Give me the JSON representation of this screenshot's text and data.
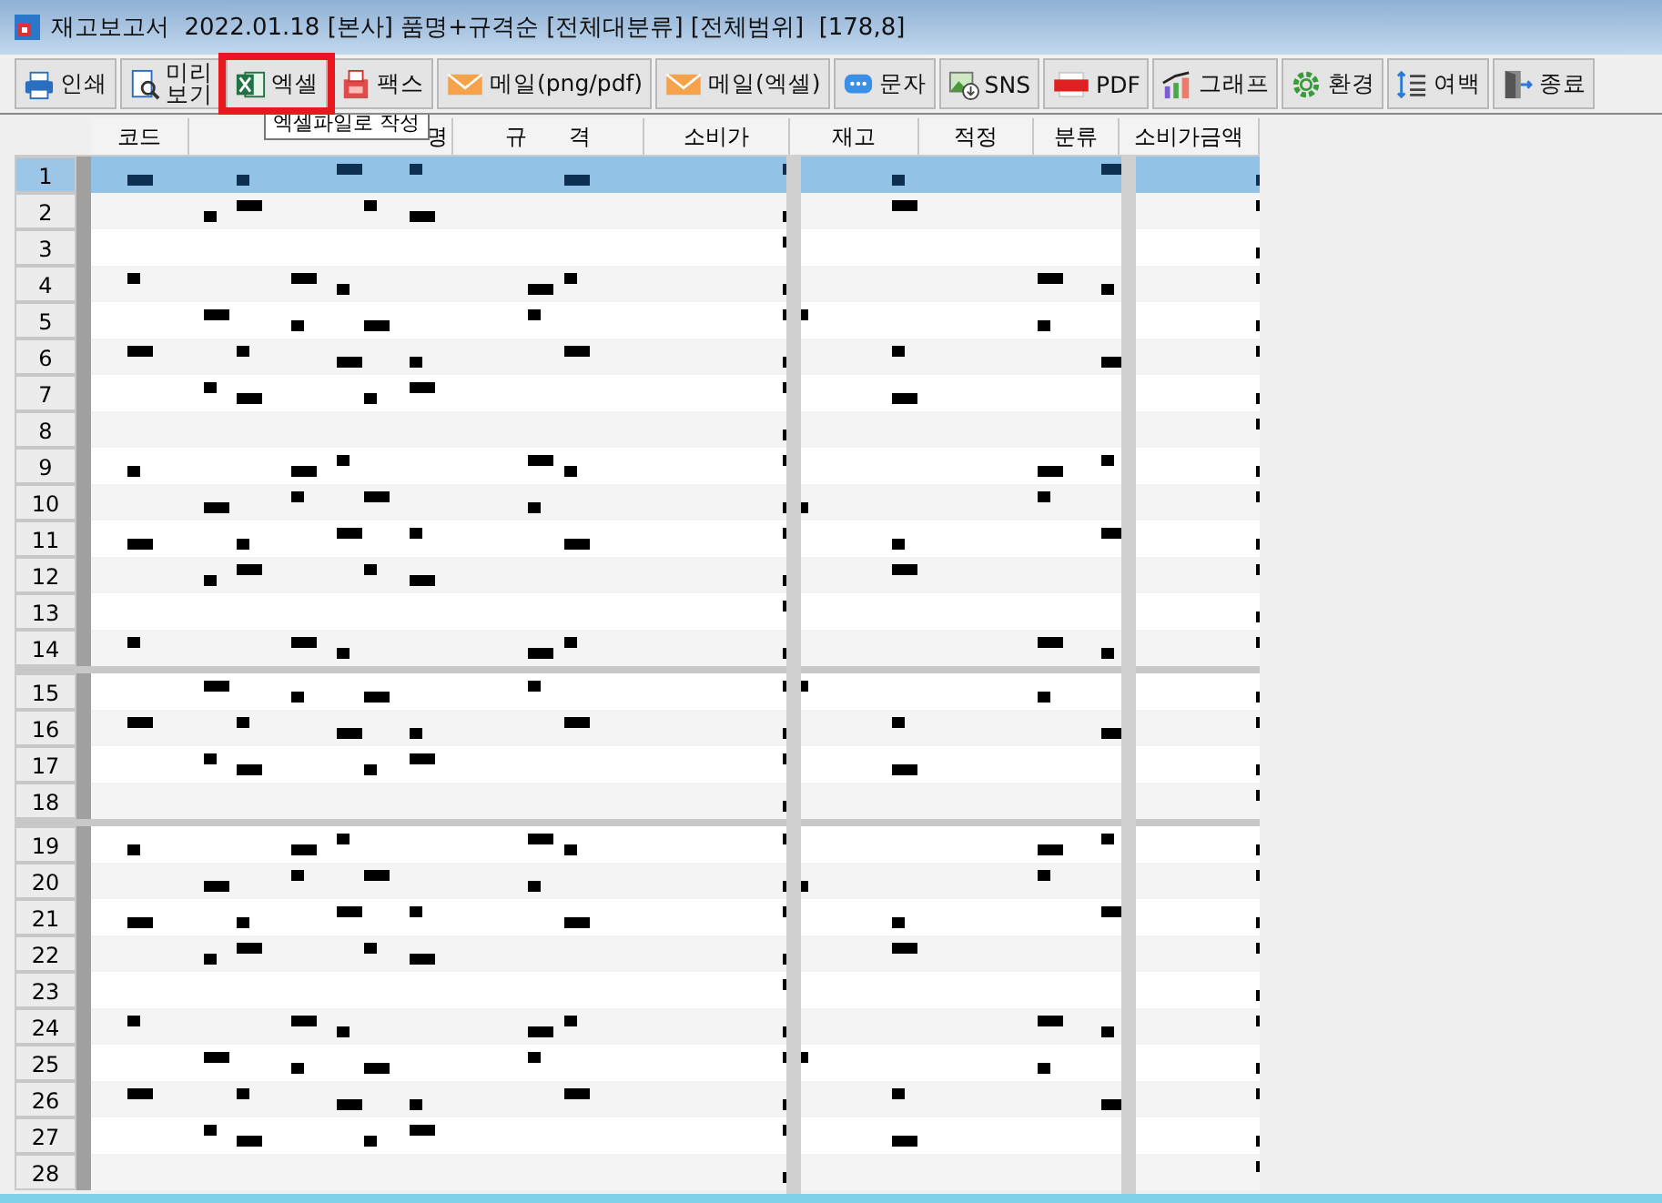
{
  "window": {
    "title": "재고보고서  2022.01.18 [본사] 품명+규격순 [전체대분류] [전체범위]  [178,8]"
  },
  "toolbar": [
    {
      "label": "인쇄",
      "kind": "print"
    },
    {
      "label": "미리\n보기",
      "kind": "preview"
    },
    {
      "label": "엑셀",
      "kind": "excel"
    },
    {
      "label": "팩스",
      "kind": "fax"
    },
    {
      "label": "메일(png/pdf)",
      "kind": "mail"
    },
    {
      "label": "메일(엑셀)",
      "kind": "mail"
    },
    {
      "label": "문자",
      "kind": "sms"
    },
    {
      "label": "SNS",
      "kind": "sns"
    },
    {
      "label": "PDF",
      "kind": "pdf"
    },
    {
      "label": "그래프",
      "kind": "chart"
    },
    {
      "label": "환경",
      "kind": "gear"
    },
    {
      "label": "여백",
      "kind": "margin"
    },
    {
      "label": "종료",
      "kind": "exit"
    }
  ],
  "tooltip": "엑셀파일로 작성",
  "table": {
    "columns": [
      "코드",
      "명",
      "규      격",
      "소비가",
      "재고",
      "적정",
      "분류",
      "소비가금액"
    ],
    "rows": [
      {
        "number": "1",
        "selected": true
      },
      {
        "number": "2",
        "selected": false
      },
      {
        "number": "3",
        "selected": false
      },
      {
        "number": "4",
        "selected": false
      },
      {
        "number": "5",
        "selected": false
      },
      {
        "number": "6",
        "selected": false
      },
      {
        "number": "7",
        "selected": false
      },
      {
        "number": "8",
        "selected": false
      },
      {
        "number": "9",
        "selected": false
      },
      {
        "number": "10",
        "selected": false
      },
      {
        "number": "11",
        "selected": false
      },
      {
        "number": "12",
        "selected": false
      },
      {
        "number": "13",
        "selected": false
      },
      {
        "number": "14",
        "selected": false
      },
      {
        "number": "15",
        "selected": false
      },
      {
        "number": "16",
        "selected": false
      },
      {
        "number": "17",
        "selected": false
      },
      {
        "number": "18",
        "selected": false
      },
      {
        "number": "19",
        "selected": false
      },
      {
        "number": "20",
        "selected": false
      },
      {
        "number": "21",
        "selected": false
      },
      {
        "number": "22",
        "selected": false
      },
      {
        "number": "23",
        "selected": false
      },
      {
        "number": "24",
        "selected": false
      },
      {
        "number": "25",
        "selected": false
      },
      {
        "number": "26",
        "selected": false
      },
      {
        "number": "27",
        "selected": false
      },
      {
        "number": "28",
        "selected": false
      }
    ]
  }
}
